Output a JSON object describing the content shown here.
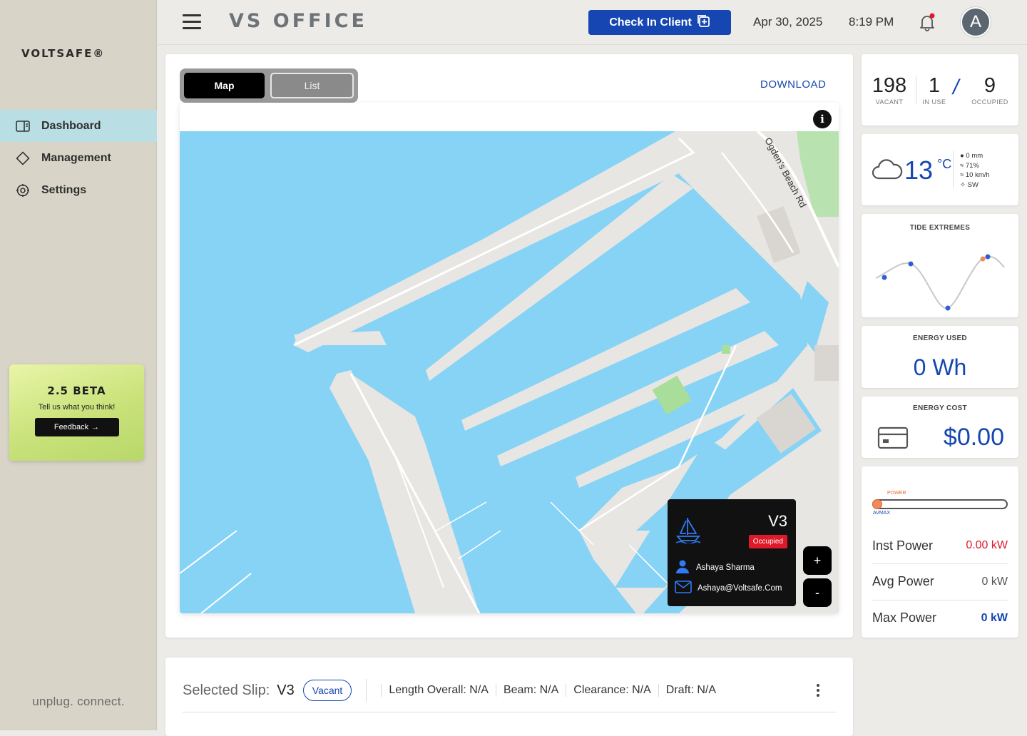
{
  "sidebar": {
    "logo": "VOLTSAFE®",
    "items": [
      {
        "label": "Dashboard",
        "icon": "dashboard-icon",
        "active": true
      },
      {
        "label": "Management",
        "icon": "diamond-icon",
        "active": false
      },
      {
        "label": "Settings",
        "icon": "gear-icon",
        "active": false
      }
    ],
    "beta": {
      "title": "2.5 BETA",
      "subtitle": "Tell us what you think!",
      "button": "Feedback"
    },
    "tagline": "unplug. connect."
  },
  "header": {
    "title": "VS OFFICE",
    "checkin_label": "Check In Client",
    "date": "Apr 30, 2025",
    "time": "8:19 PM",
    "avatar_initial": "A",
    "has_notification": true
  },
  "map_panel": {
    "tabs": [
      {
        "label": "Map",
        "active": true
      },
      {
        "label": "List",
        "active": false
      }
    ],
    "download_label": "DOWNLOAD",
    "info_icon": "i",
    "road_label": "Ogden's Beach Rd",
    "popup": {
      "slip": "V3",
      "status": "Occupied",
      "name": "Ashaya Sharma",
      "email": "Ashaya@Voltsafe.Com"
    },
    "zoom_in": "+",
    "zoom_out": "-"
  },
  "stats": {
    "vacant": {
      "value": "198",
      "label": "VACANT"
    },
    "in_use": {
      "value": "1",
      "label": "IN USE"
    },
    "separator": "/",
    "occupied": {
      "value": "9",
      "label": "OCCUPIED"
    }
  },
  "weather": {
    "temp": "13",
    "unit": "°C",
    "precip": "0 mm",
    "humidity": "71%",
    "wind": "10 km/h",
    "direction": "SW"
  },
  "tide": {
    "title": "TIDE EXTREMES"
  },
  "energy_used": {
    "title": "ENERGY USED",
    "value": "0 Wh"
  },
  "energy_cost": {
    "title": "ENERGY COST",
    "value": "$0.00"
  },
  "power": {
    "bar_top_label": "POWER",
    "bar_bottom_label": "AVMAX",
    "bar_fill": 0,
    "rows": [
      {
        "label": "Inst Power",
        "value": "0.00 kW",
        "color": "#e0192a"
      },
      {
        "label": "Avg Power",
        "value": "0 kW",
        "color": "#555555"
      },
      {
        "label": "Max Power",
        "value": "0 kW",
        "color": "#1546b1"
      }
    ]
  },
  "selected_slip": {
    "label": "Selected Slip:",
    "value": "V3",
    "status": "Vacant",
    "attributes": [
      {
        "text": "Length Overall: N/A"
      },
      {
        "text": "Beam: N/A"
      },
      {
        "text": "Clearance: N/A"
      },
      {
        "text": "Draft: N/A"
      }
    ]
  },
  "colors": {
    "accent": "#1546b1",
    "sidebar": "#d8d4c8",
    "active_nav": "#b9dfe5",
    "water": "#86d3f6",
    "land": "#e8e6e3",
    "alert": "#e0192a"
  }
}
